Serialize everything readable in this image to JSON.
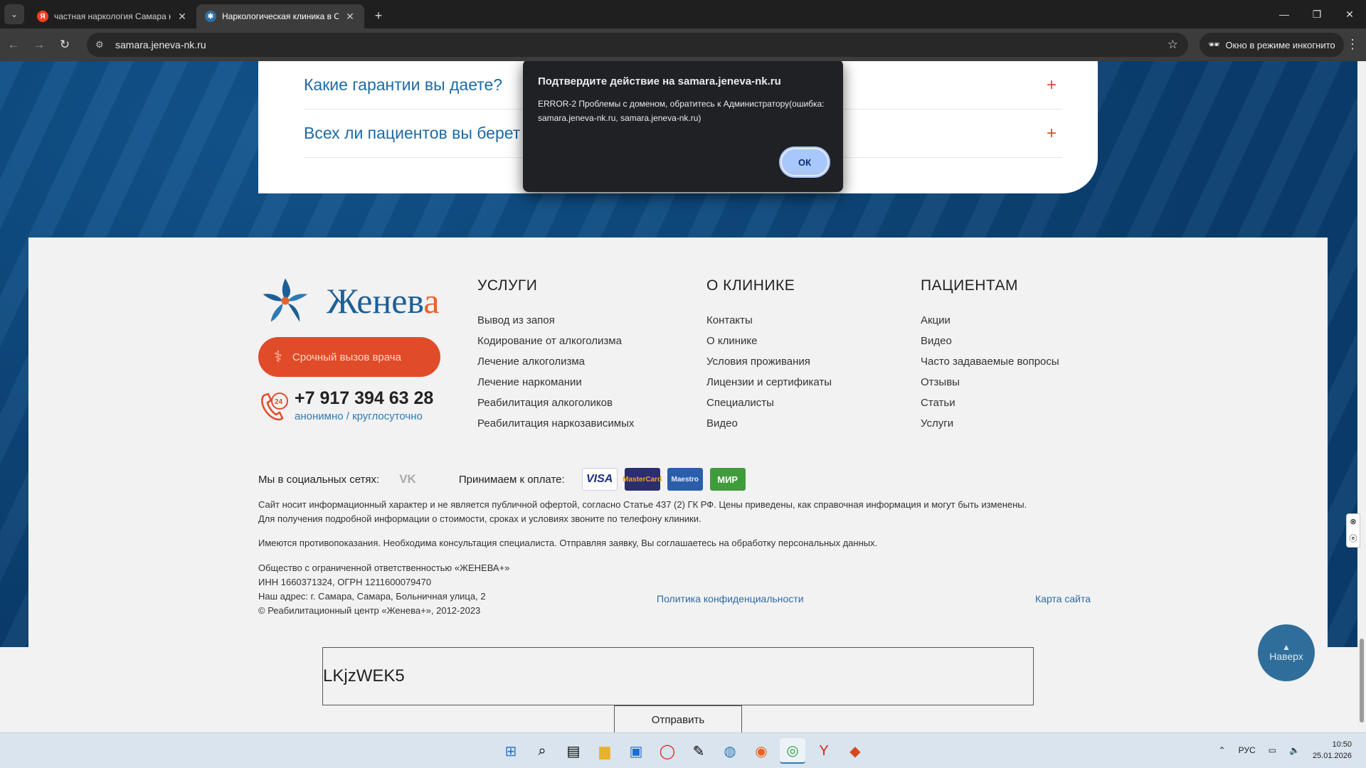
{
  "browser": {
    "tabs": [
      {
        "title": "частная наркология Самара к",
        "favicon": "yandex-icon",
        "active": false
      },
      {
        "title": "Наркологическая клиника в С",
        "favicon": "site-icon",
        "active": true
      }
    ],
    "url": "samara.jeneva-nk.ru",
    "incognito_label": "Окно в режиме инкогнито"
  },
  "faq": {
    "q1": "Какие гарантии вы даете?",
    "q2": "Всех ли пациентов вы берет"
  },
  "dialog": {
    "title": "Подтвердите действие на samara.jeneva-nk.ru",
    "message": "ERROR-2 Проблемы с доменом, обратитесь к Администратору(ошибка: samara.jeneva-nk.ru, samara.jeneva-nk.ru)",
    "ok_label": "ОК"
  },
  "footer": {
    "logo_text_main": "Женев",
    "logo_text_accent": "а",
    "urgent_call": "Срочный вызов врача",
    "phone": "+7 917 394 63 28",
    "phone_sub": "анонимно / круглосуточно",
    "phone_icon_text": "24",
    "services": {
      "heading": "УСЛУГИ",
      "items": [
        "Вывод из запоя",
        "Кодирование от алкоголизма",
        "Лечение алкоголизма",
        "Лечение наркомании",
        "Реабилитация алкоголиков",
        "Реабилитация наркозависимых"
      ]
    },
    "clinic": {
      "heading": "О КЛИНИКЕ",
      "items": [
        "Контакты",
        "О клинике",
        "Условия проживания",
        "Лицензии и сертификаты",
        "Специалисты",
        "Видео"
      ]
    },
    "patients": {
      "heading": "ПАЦИЕНТАМ",
      "items": [
        "Акции",
        "Видео",
        "Часто задаваемые вопросы",
        "Отзывы",
        "Статьи",
        "Услуги"
      ]
    },
    "socials_label": "Мы в социальных сетях:",
    "vk_label": "VK",
    "payment_label": "Принимаем к оплате:",
    "payment_cards": [
      "VISA",
      "MasterCard",
      "Maestro",
      "МИР"
    ],
    "disclaimer1": "Сайт носит информационный характер и не является публичной офертой, согласно Статье 437 (2) ГК РФ. Цены приведены, как справочная информация и могут быть изменены.",
    "disclaimer2": "Для получения подробной информации о стоимости, сроках и условиях звоните по телефону клиники.",
    "disclaimer3": "Имеются противопоказания. Необходима консультация специалиста. Отправляя заявку, Вы соглашаетесь на обработку персональных данных.",
    "legal": [
      "Общество с ограниченной ответственностью «ЖЕНЕВА+»",
      "ИНН 1660371324, ОГРН 1211600079470",
      "Наш адрес: г. Самара, Самара, Больничная улица, 2",
      "© Реабилитационный центр «Женева+», 2012-2023"
    ],
    "policy_link": "Политика конфиденциальности",
    "sitemap_link": "Карта сайта"
  },
  "to_top_label": "Наверх",
  "captcha": {
    "value": "LKjzWEK5",
    "submit_label": "Отправить"
  },
  "taskbar": {
    "lang": "РУС",
    "time": "10:50",
    "date": "25.01.2026"
  },
  "colors": {
    "accent_red": "#e04b2a",
    "brand_blue": "#1c5f96",
    "dialog_bg": "#202124",
    "ok_button": "#a8c7fa"
  }
}
